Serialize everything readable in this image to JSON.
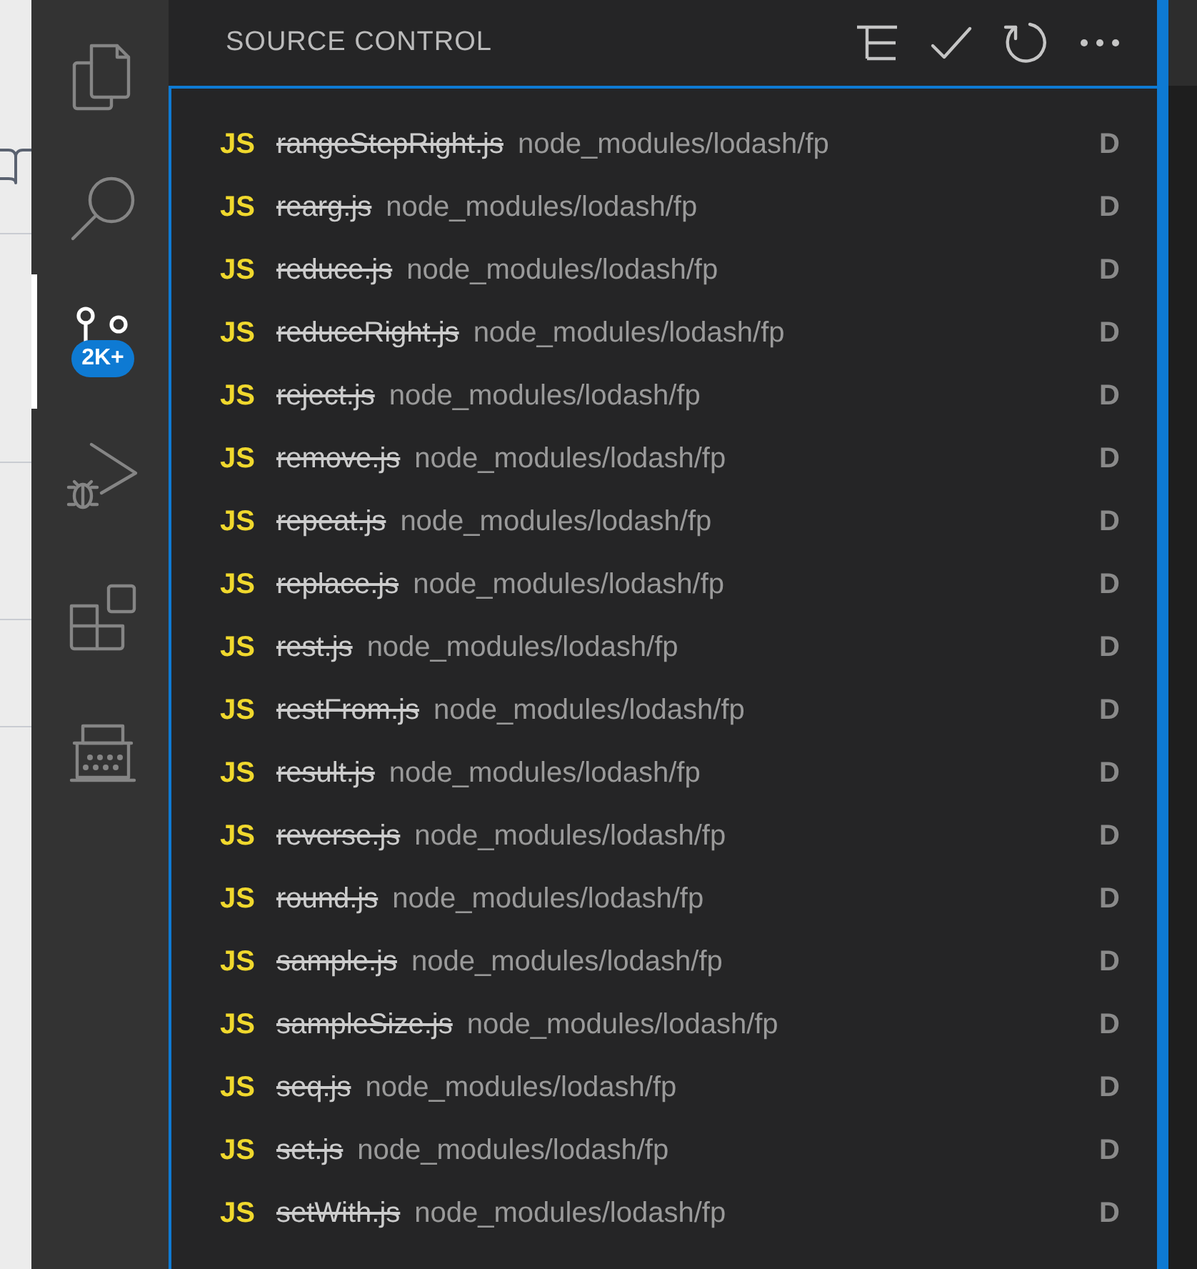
{
  "panel": {
    "title": "SOURCE CONTROL"
  },
  "activity_bar": {
    "items": [
      {
        "kind": "files",
        "selected": false
      },
      {
        "kind": "search",
        "selected": false
      },
      {
        "kind": "scm",
        "selected": true,
        "badge": "2K+"
      },
      {
        "kind": "debug",
        "selected": false
      },
      {
        "kind": "extensions",
        "selected": false
      },
      {
        "kind": "typewriter",
        "selected": false
      }
    ]
  },
  "changes": [
    {
      "lang": "JS",
      "file": "rangeStepRight.js",
      "path": "node_modules/lodash/fp",
      "status": "D",
      "deleted": true
    },
    {
      "lang": "JS",
      "file": "rearg.js",
      "path": "node_modules/lodash/fp",
      "status": "D",
      "deleted": true
    },
    {
      "lang": "JS",
      "file": "reduce.js",
      "path": "node_modules/lodash/fp",
      "status": "D",
      "deleted": true
    },
    {
      "lang": "JS",
      "file": "reduceRight.js",
      "path": "node_modules/lodash/fp",
      "status": "D",
      "deleted": true
    },
    {
      "lang": "JS",
      "file": "reject.js",
      "path": "node_modules/lodash/fp",
      "status": "D",
      "deleted": true
    },
    {
      "lang": "JS",
      "file": "remove.js",
      "path": "node_modules/lodash/fp",
      "status": "D",
      "deleted": true
    },
    {
      "lang": "JS",
      "file": "repeat.js",
      "path": "node_modules/lodash/fp",
      "status": "D",
      "deleted": true
    },
    {
      "lang": "JS",
      "file": "replace.js",
      "path": "node_modules/lodash/fp",
      "status": "D",
      "deleted": true
    },
    {
      "lang": "JS",
      "file": "rest.js",
      "path": "node_modules/lodash/fp",
      "status": "D",
      "deleted": true
    },
    {
      "lang": "JS",
      "file": "restFrom.js",
      "path": "node_modules/lodash/fp",
      "status": "D",
      "deleted": true
    },
    {
      "lang": "JS",
      "file": "result.js",
      "path": "node_modules/lodash/fp",
      "status": "D",
      "deleted": true
    },
    {
      "lang": "JS",
      "file": "reverse.js",
      "path": "node_modules/lodash/fp",
      "status": "D",
      "deleted": true
    },
    {
      "lang": "JS",
      "file": "round.js",
      "path": "node_modules/lodash/fp",
      "status": "D",
      "deleted": true
    },
    {
      "lang": "JS",
      "file": "sample.js",
      "path": "node_modules/lodash/fp",
      "status": "D",
      "deleted": true
    },
    {
      "lang": "JS",
      "file": "sampleSize.js",
      "path": "node_modules/lodash/fp",
      "status": "D",
      "deleted": true
    },
    {
      "lang": "JS",
      "file": "seq.js",
      "path": "node_modules/lodash/fp",
      "status": "D",
      "deleted": true
    },
    {
      "lang": "JS",
      "file": "set.js",
      "path": "node_modules/lodash/fp",
      "status": "D",
      "deleted": true
    },
    {
      "lang": "JS",
      "file": "setWith.js",
      "path": "node_modules/lodash/fp",
      "status": "D",
      "deleted": true
    }
  ]
}
